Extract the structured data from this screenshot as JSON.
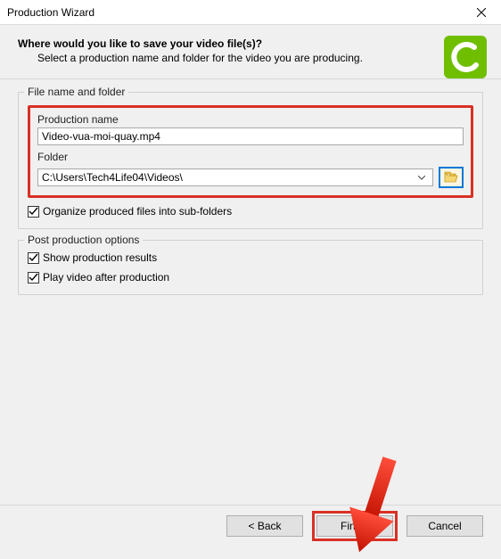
{
  "window": {
    "title": "Production Wizard"
  },
  "header": {
    "heading": "Where would you like to save your video file(s)?",
    "subtext": "Select a production name and folder for the video you are producing."
  },
  "fileGroup": {
    "legend": "File name and folder",
    "productionNameLabel": "Production name",
    "productionNameValue": "Video-vua-moi-quay.mp4",
    "folderLabel": "Folder",
    "folderValue": "C:\\Users\\Tech4Life04\\Videos\\",
    "organizeLabel": "Organize produced files into sub-folders",
    "organizeChecked": true
  },
  "postGroup": {
    "legend": "Post production options",
    "showResultsLabel": "Show production results",
    "showResultsChecked": true,
    "playAfterLabel": "Play video after production",
    "playAfterChecked": true
  },
  "buttons": {
    "back": "< Back",
    "finish": "Finish",
    "cancel": "Cancel"
  },
  "accent": {
    "highlight": "#d93025",
    "windowsBlue": "#0078d7",
    "logoGreen": "#6fbf00"
  }
}
